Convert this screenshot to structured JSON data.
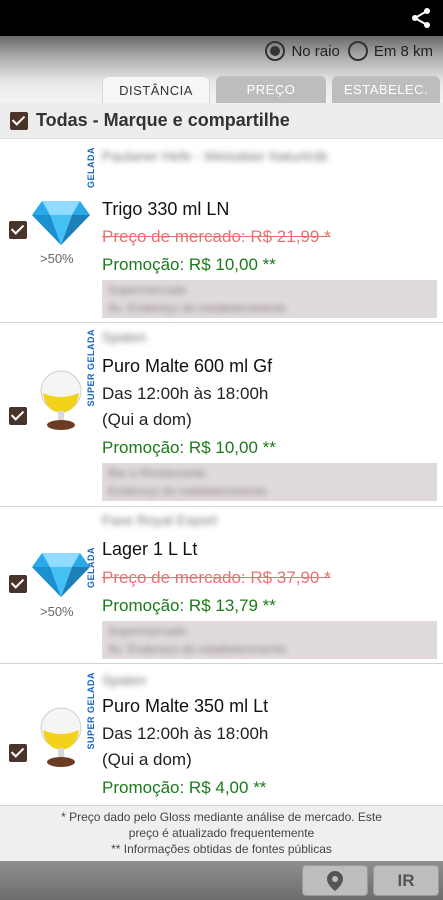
{
  "radius": {
    "option1": "No raio",
    "option2": "Em 8 km",
    "selected": "No raio"
  },
  "tabs": [
    "DISTÂNCIA",
    "PREÇO",
    "ESTABELEC."
  ],
  "select_all_label": "Todas - Marque e compartilhe",
  "items": [
    {
      "brand": "Paulaner Hefe - Weissbier Naturtrüb",
      "vertical": "GELADA",
      "icon": "diamond-icon",
      "discount": ">50%",
      "product": "Trigo 330 ml LN",
      "market": "Preço de mercado: R$ 21,99 *",
      "promo": "Promoção: R$ 10,00  **",
      "store1": "Supermercado",
      "store2": "Av. Endereço do estabelecimento"
    },
    {
      "brand": "Spaten",
      "vertical": "SUPER GELADA",
      "icon": "beer-glass-icon",
      "product": "Puro Malte 600 ml Gf",
      "hours": "Das 12:00h às 18:00h",
      "days": "(Qui a dom)",
      "promo": "Promoção: R$ 10,00  **",
      "store1": "Bar e Restaurante",
      "store2": "Endereço do estabelecimento"
    },
    {
      "brand": "Faxe Royal Export",
      "vertical": "GELADA",
      "icon": "diamond-icon",
      "discount": ">50%",
      "product": "Lager 1 L Lt",
      "market": "Preço de mercado: R$ 37,90 *",
      "promo": "Promoção: R$ 13,79  **",
      "store1": "Supermercado",
      "store2": "Av. Endereço do estabelecimento"
    },
    {
      "brand": "Spaten",
      "vertical": "SUPER GELADA",
      "icon": "beer-glass-icon",
      "product": "Puro Malte 350 ml Lt",
      "hours": "Das 12:00h às 18:00h",
      "days": "(Qui a dom)",
      "promo": "Promoção: R$ 4,00  **"
    }
  ],
  "footer": {
    "line1": "* Preço dado pelo Gloss mediante análise de mercado. Este",
    "line2": "preço é atualizado frequentemente",
    "line3": "** Informações obtidas de fontes públicas"
  },
  "go_label": "IR",
  "colors": {
    "promo": "#1b7a1b",
    "market": "#e57373",
    "checkbox": "#4a3328",
    "vertical": "#1565c0"
  }
}
